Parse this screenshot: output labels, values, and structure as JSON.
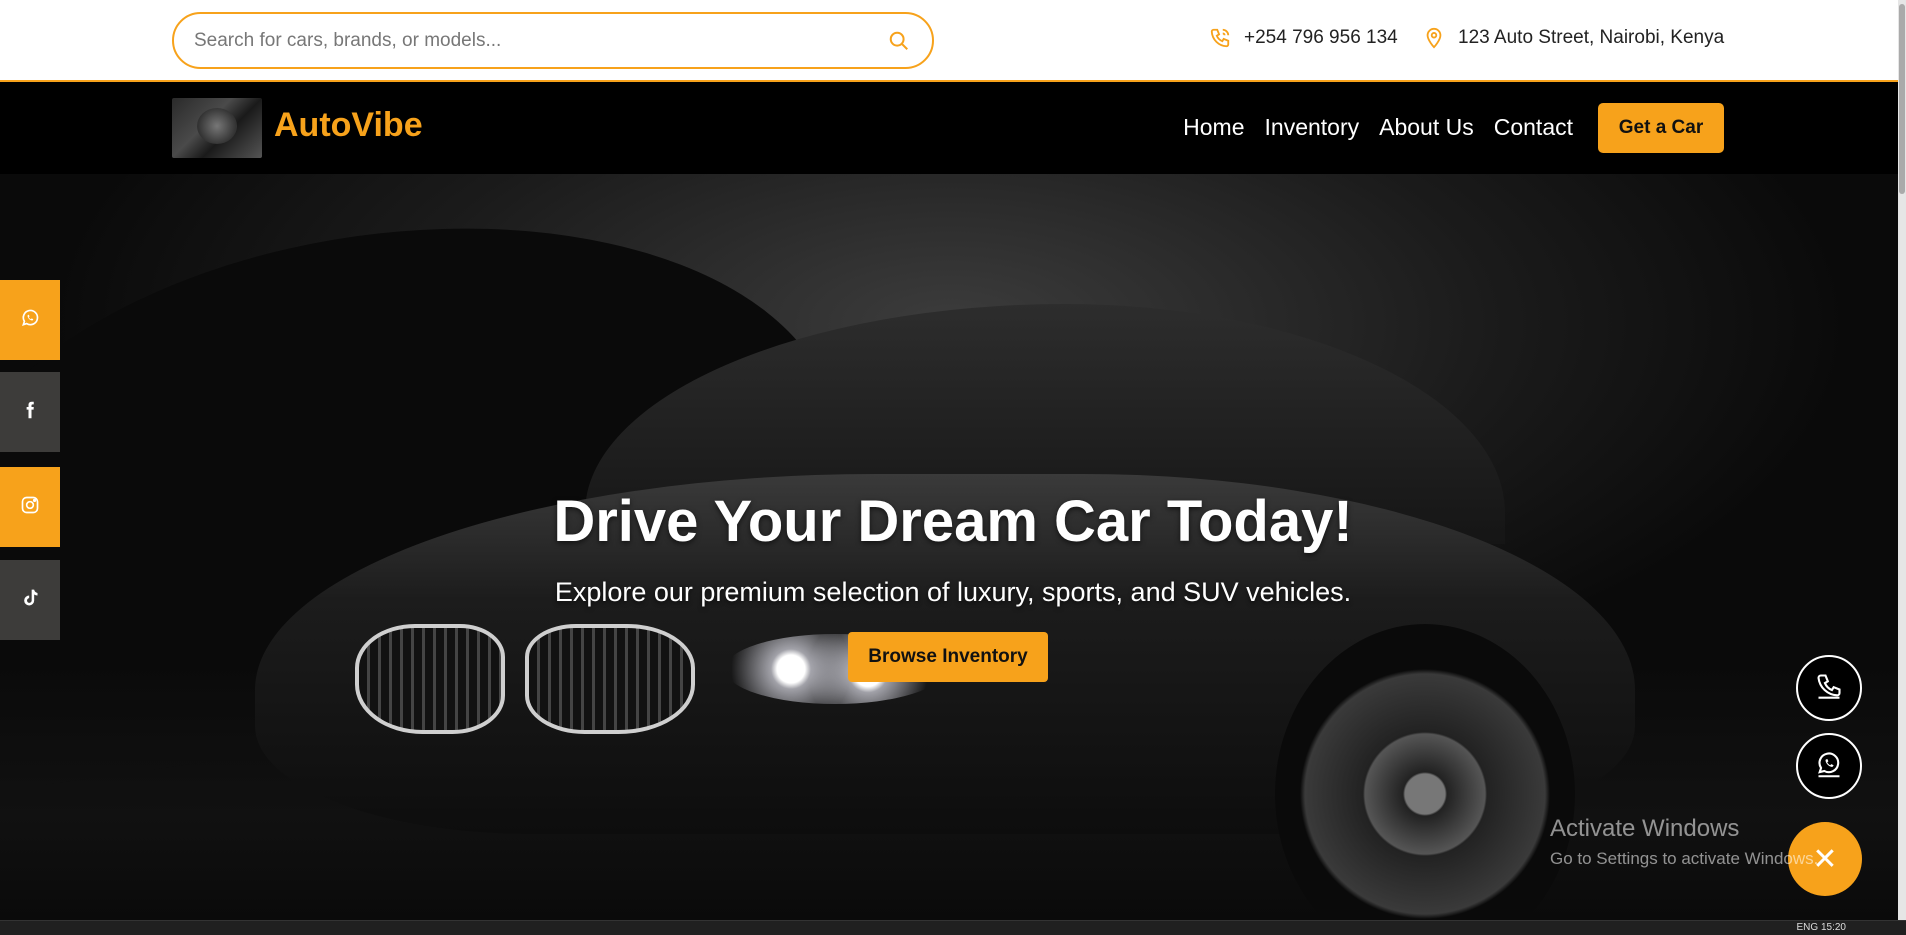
{
  "search": {
    "placeholder": "Search for cars, brands, or models..."
  },
  "contact": {
    "phone": "+254 796 956 134",
    "address": "123 Auto Street, Nairobi, Kenya"
  },
  "nav": {
    "brand": "AutoVibe",
    "links": [
      "Home",
      "Inventory",
      "About Us",
      "Contact"
    ],
    "cta": "Get a Car"
  },
  "hero": {
    "title": "Drive Your Dream Car Today!",
    "subtitle": "Explore our premium selection of luxury, sports, and SUV vehicles.",
    "button": "Browse Inventory"
  },
  "social": [
    "whatsapp-icon",
    "facebook-icon",
    "instagram-icon",
    "tiktok-icon"
  ],
  "floating": {
    "close_symbol": "✕"
  },
  "watermark": {
    "line1": "Activate Windows",
    "line2": "Go to Settings to activate Windows."
  },
  "taskbar": {
    "tray": "ENG 15:20"
  },
  "colors": {
    "accent": "#f7a21b",
    "nav_bg": "#000000",
    "sidebar_dark": "#3d3c3a"
  }
}
